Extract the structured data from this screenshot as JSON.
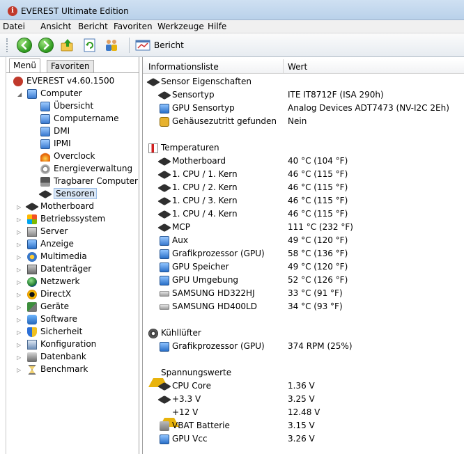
{
  "window": {
    "title": "EVEREST Ultimate Edition",
    "app_icon_glyph": "i"
  },
  "menubar": [
    "Datei",
    "Ansicht",
    "Bericht",
    "Favoriten",
    "Werkzeuge",
    "Hilfe"
  ],
  "toolbar": {
    "buttons": [
      "back-icon",
      "forward-icon",
      "up-folder-icon",
      "refresh-icon",
      "users-icon"
    ],
    "report_label": "Bericht"
  },
  "left_panel": {
    "tabs": [
      "Menü",
      "Favoriten"
    ],
    "active_tab": "Menü",
    "root": "EVEREST v4.60.1500",
    "computer": {
      "label": "Computer",
      "children": [
        "Übersicht",
        "Computername",
        "DMI",
        "IPMI",
        "Overclock",
        "Energieverwaltung",
        "Tragbarer Computer",
        "Sensoren"
      ],
      "selected": "Sensoren"
    },
    "categories": [
      "Motherboard",
      "Betriebssystem",
      "Server",
      "Anzeige",
      "Multimedia",
      "Datenträger",
      "Netzwerk",
      "DirectX",
      "Geräte",
      "Software",
      "Sicherheit",
      "Konfiguration",
      "Datenbank",
      "Benchmark"
    ]
  },
  "right_panel": {
    "columns": [
      "Informationsliste",
      "Wert"
    ],
    "sections": [
      {
        "title": "Sensor Eigenschaften",
        "rows": [
          {
            "label": "Sensortyp",
            "value": "ITE IT8712F  (ISA 290h)"
          },
          {
            "label": "GPU Sensortyp",
            "value": "Analog Devices ADT7473  (NV-I2C 2Eh)"
          },
          {
            "label": "Gehäusezutritt gefunden",
            "value": "Nein"
          }
        ]
      },
      {
        "title": "Temperaturen",
        "rows": [
          {
            "label": "Motherboard",
            "value": "40 °C  (104 °F)"
          },
          {
            "label": "1. CPU / 1. Kern",
            "value": "46 °C  (115 °F)"
          },
          {
            "label": "1. CPU / 2. Kern",
            "value": "46 °C  (115 °F)"
          },
          {
            "label": "1. CPU / 3. Kern",
            "value": "46 °C  (115 °F)"
          },
          {
            "label": "1. CPU / 4. Kern",
            "value": "46 °C  (115 °F)"
          },
          {
            "label": "MCP",
            "value": "111 °C  (232 °F)"
          },
          {
            "label": "Aux",
            "value": "49 °C  (120 °F)"
          },
          {
            "label": "Grafikprozessor (GPU)",
            "value": "58 °C  (136 °F)"
          },
          {
            "label": "GPU Speicher",
            "value": "49 °C  (120 °F)"
          },
          {
            "label": "GPU Umgebung",
            "value": "52 °C  (126 °F)"
          },
          {
            "label": "SAMSUNG HD322HJ",
            "value": "33 °C  (91 °F)"
          },
          {
            "label": "SAMSUNG HD400LD",
            "value": "34 °C  (93 °F)"
          }
        ]
      },
      {
        "title": "Kühllüfter",
        "rows": [
          {
            "label": "Grafikprozessor (GPU)",
            "value": "374 RPM  (25%)"
          }
        ]
      },
      {
        "title": "Spannungswerte",
        "rows": [
          {
            "label": "CPU Core",
            "value": "1.36 V"
          },
          {
            "label": "+3.3 V",
            "value": "3.25 V"
          },
          {
            "label": "+12 V",
            "value": "12.48 V"
          },
          {
            "label": "VBAT Batterie",
            "value": "3.15 V"
          },
          {
            "label": "GPU Vcc",
            "value": "3.26 V"
          }
        ]
      }
    ]
  }
}
